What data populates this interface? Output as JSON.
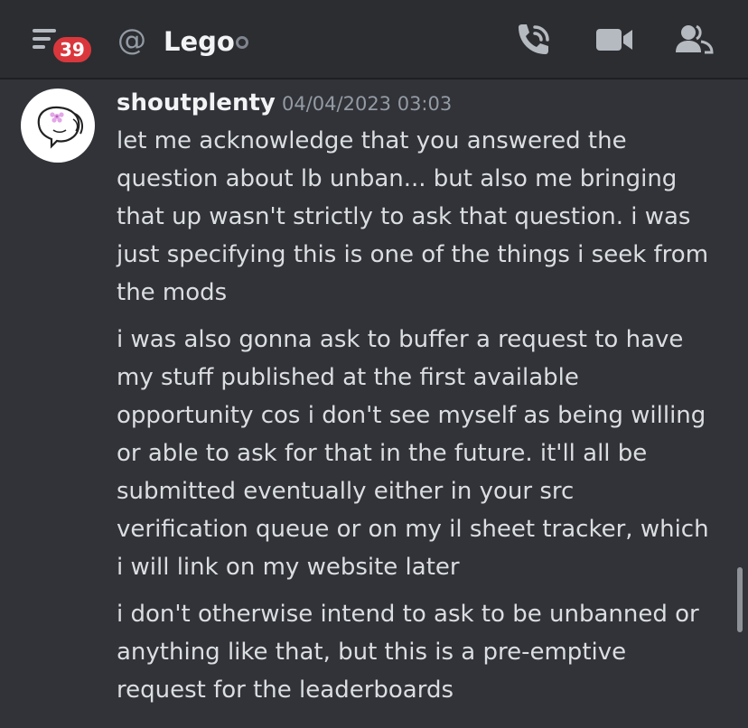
{
  "header": {
    "menu_icon": "hamburger-menu-icon",
    "unread_badge": "39",
    "at_icon": "at-sign-icon",
    "channel_name": "Lego",
    "status": "offline",
    "actions": [
      {
        "name": "voice-call-button",
        "icon": "phone-call-icon"
      },
      {
        "name": "video-call-button",
        "icon": "video-camera-icon"
      },
      {
        "name": "member-list-button",
        "icon": "members-icon"
      }
    ]
  },
  "message": {
    "author": "shoutplenty",
    "timestamp": "04/04/2023 03:03",
    "avatar_icon": "doodle-avatar",
    "paragraphs": [
      {
        "lines": [
          "let me acknowledge that you answered the",
          "question about lb unban... but also me bringing",
          "that up wasn't strictly to ask that question. i was",
          "just specifying this is one of the things i seek from",
          "the mods"
        ]
      },
      {
        "lines": [
          "i was also gonna ask to buffer a request to have",
          "my stuff published at the first available",
          "opportunity cos i don't see myself as being willing",
          "or able to ask for that in the future. it'll all be",
          "submitted eventually either in your src",
          "verification queue or on my il sheet tracker, which",
          "i will link on my website later"
        ]
      },
      {
        "lines": [
          "i don't otherwise intend to ask to be unbanned or",
          "anything like that, but this is a pre-emptive",
          "request for the leaderboards"
        ]
      }
    ]
  },
  "colors": {
    "background": "#313338",
    "header": "#2b2d31",
    "badge": "#da373c",
    "text": "#dbdee1",
    "muted": "#949ba4"
  }
}
